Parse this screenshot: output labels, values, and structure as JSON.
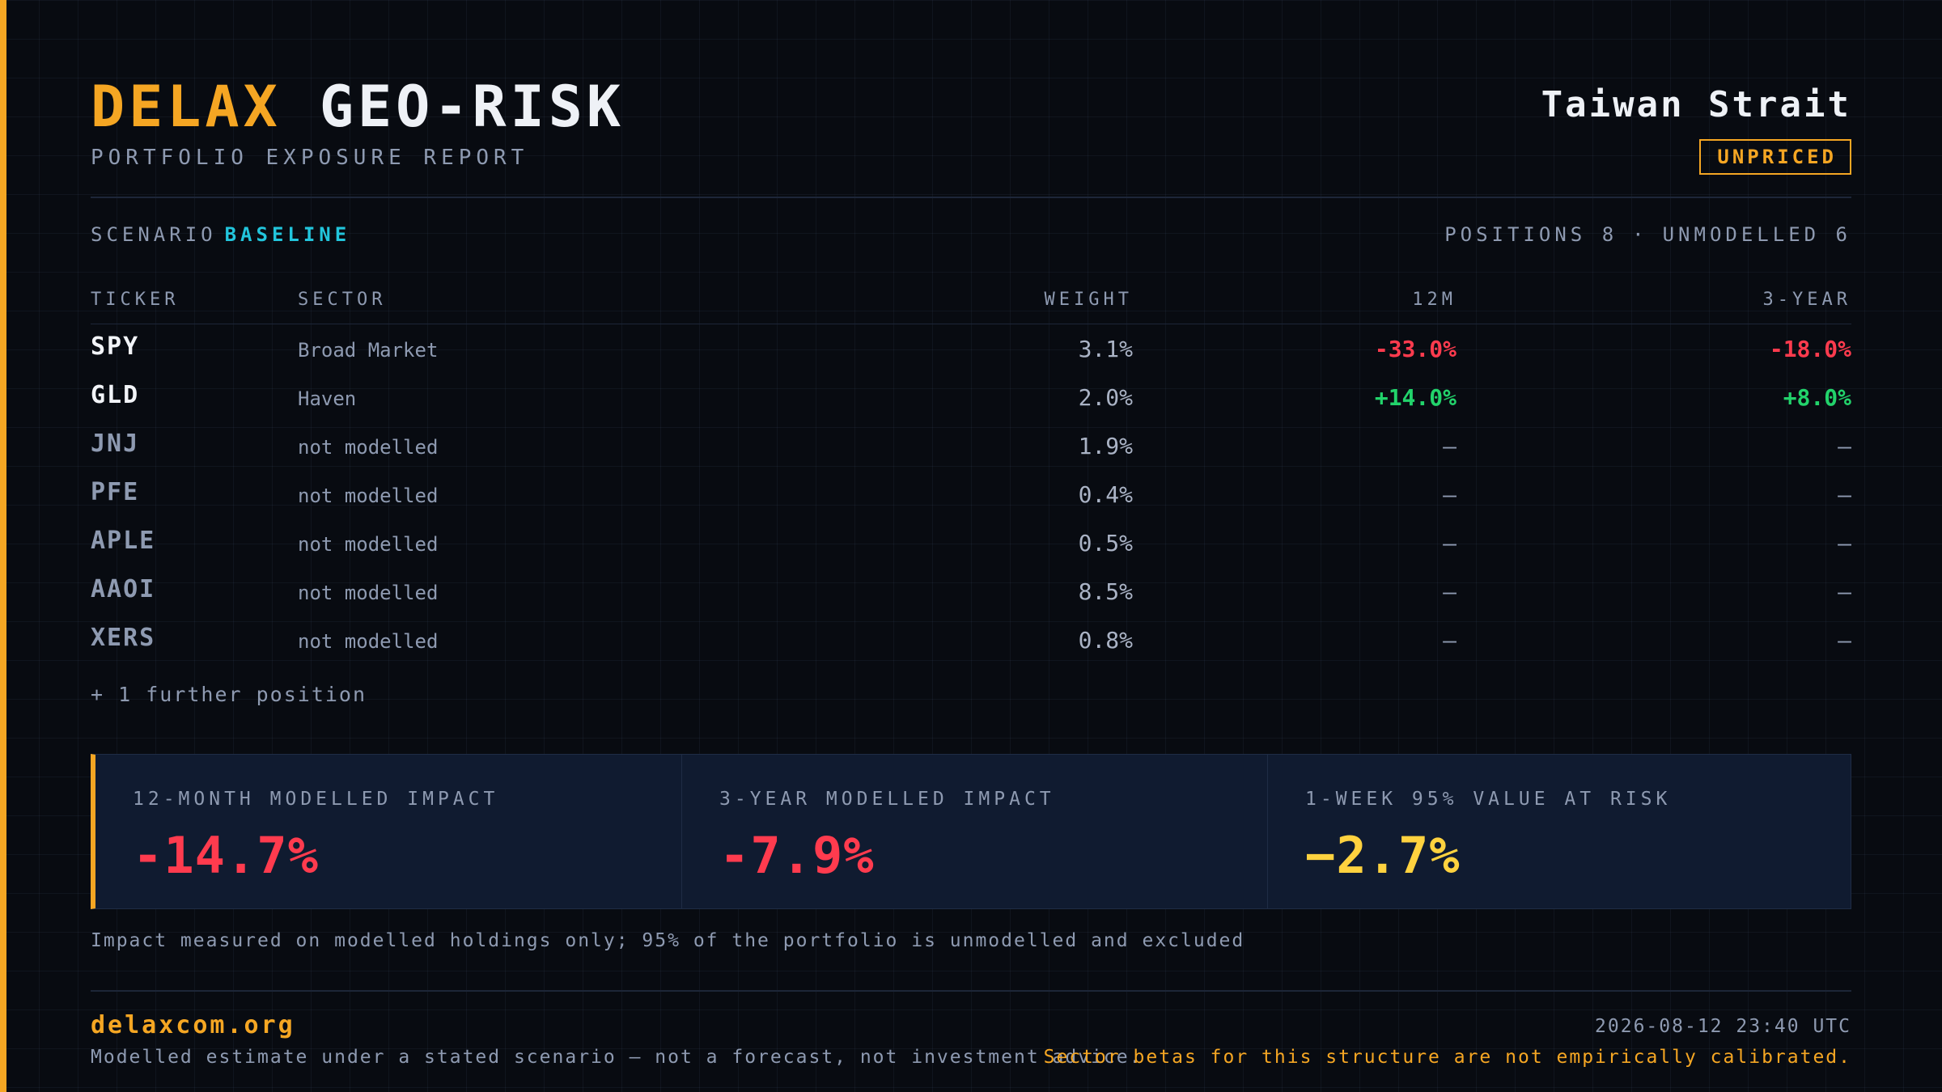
{
  "header": {
    "title_brand": "DELAX",
    "title_rest": "GEO-RISK",
    "subtitle": "PORTFOLIO EXPOSURE REPORT",
    "region": "Taiwan Strait",
    "badge": "UNPRICED"
  },
  "scenario": {
    "label": "SCENARIO",
    "value": "BASELINE",
    "positions_label": "POSITIONS",
    "positions_count": "8",
    "separator": "·",
    "unmodelled_label": "UNMODELLED",
    "unmodelled_count": "6"
  },
  "table": {
    "columns": {
      "ticker": "TICKER",
      "sector": "SECTOR",
      "weight": "WEIGHT",
      "m12": "12M",
      "y3": "3-YEAR"
    },
    "rows": [
      {
        "ticker": "SPY",
        "sector": "Broad Market",
        "weight": "3.1%",
        "m12": "-33.0%",
        "y3": "-18.0%"
      },
      {
        "ticker": "GLD",
        "sector": "Haven",
        "weight": "2.0%",
        "m12": "+14.0%",
        "y3": "+8.0%"
      },
      {
        "ticker": "JNJ",
        "sector": "not modelled",
        "weight": "1.9%",
        "m12": "—",
        "y3": "—"
      },
      {
        "ticker": "PFE",
        "sector": "not modelled",
        "weight": "0.4%",
        "m12": "—",
        "y3": "—"
      },
      {
        "ticker": "APLE",
        "sector": "not modelled",
        "weight": "0.5%",
        "m12": "—",
        "y3": "—"
      },
      {
        "ticker": "AAOI",
        "sector": "not modelled",
        "weight": "8.5%",
        "m12": "—",
        "y3": "—"
      },
      {
        "ticker": "XERS",
        "sector": "not modelled",
        "weight": "0.8%",
        "m12": "—",
        "y3": "—"
      }
    ],
    "more": "+ 1 further position"
  },
  "metrics": [
    {
      "label": "12-MONTH MODELLED IMPACT",
      "value": "-14.7%"
    },
    {
      "label": "3-YEAR MODELLED IMPACT",
      "value": "-7.9%"
    },
    {
      "label": "1-WEEK 95% VALUE AT RISK",
      "value": "−2.7%"
    }
  ],
  "footnote": "Impact measured on modelled holdings only; 95% of the portfolio is unmodelled and excluded",
  "footer": {
    "site": "delaxcom.org",
    "timestamp": "2026-08-12 23:40 UTC",
    "disclaimer": "Modelled estimate under a stated scenario — not a forecast, not investment advice.",
    "warning": "Sector betas for this structure are not empirically calibrated."
  },
  "colors": {
    "accent": "#f5a623",
    "negative": "#ff3b4e",
    "positive": "#22d36b",
    "scenario": "#22c5dc",
    "var": "#ffd23f"
  }
}
